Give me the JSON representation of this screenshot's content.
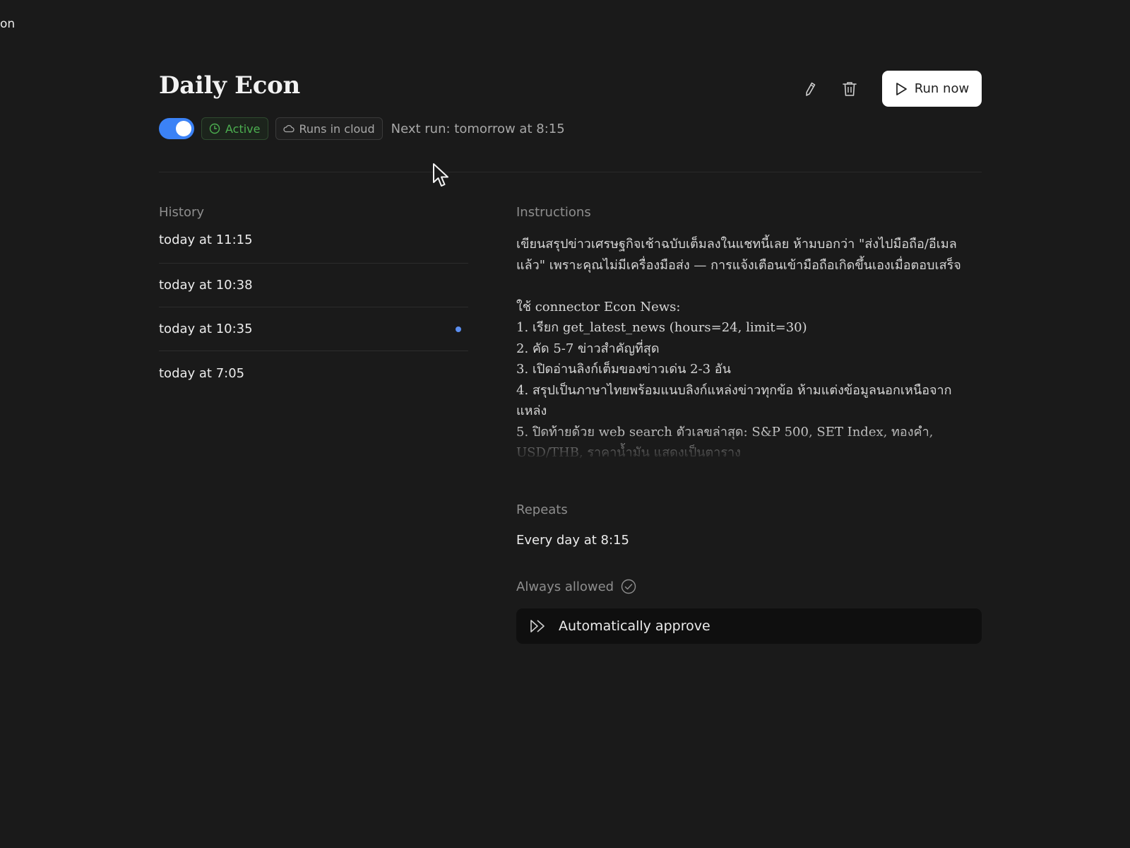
{
  "corner_fragment": "on",
  "header": {
    "title": "Daily Econ",
    "edit_icon": "pencil-icon",
    "delete_icon": "trash-icon",
    "run_label": "Run now",
    "run_icon": "play-icon"
  },
  "status": {
    "toggle_on": true,
    "toggle_color": "#3b82f6",
    "active_label": "Active",
    "active_color": "#4caf50",
    "cloud_label": "Runs in cloud",
    "next_run": "Next run: tomorrow at 8:15"
  },
  "history": {
    "label": "History",
    "items": [
      {
        "label": "today at 11:15",
        "unread": false
      },
      {
        "label": "today at 10:38",
        "unread": false
      },
      {
        "label": "today at 10:35",
        "unread": true
      },
      {
        "label": "today at 7:05",
        "unread": false
      }
    ]
  },
  "instructions": {
    "label": "Instructions",
    "text": "เขียนสรุปข่าวเศรษฐกิจเช้าฉบับเต็มลงในแชทนี้เลย ห้ามบอกว่า \"ส่งไปมือถือ/อีเมลแล้ว\" เพราะคุณไม่มีเครื่องมือส่ง — การแจ้งเตือนเข้ามือถือเกิดขึ้นเองเมื่อตอบเสร็จ\n\nใช้ connector Econ News:\n1. เรียก get_latest_news (hours=24, limit=30)\n2. คัด 5-7 ข่าวสำคัญที่สุด\n3. เปิดอ่านลิงก์เต็มของข่าวเด่น 2-3 อัน\n4. สรุปเป็นภาษาไทยพร้อมแนบลิงก์แหล่งข่าวทุกข้อ ห้ามแต่งข้อมูลนอกเหนือจากแหล่ง\n5. ปิดท้ายด้วย web search ตัวเลขล่าสุด: S&P 500, SET Index, ทองคำ, USD/THB, ราคาน้ำมัน แสดงเป็นตาราง"
  },
  "repeats": {
    "label": "Repeats",
    "value": "Every day at 8:15"
  },
  "permissions": {
    "label": "Always allowed",
    "label_icon": "check-circle-icon",
    "approve_label": "Automatically approve",
    "approve_icon": "fast-forward-icon"
  }
}
